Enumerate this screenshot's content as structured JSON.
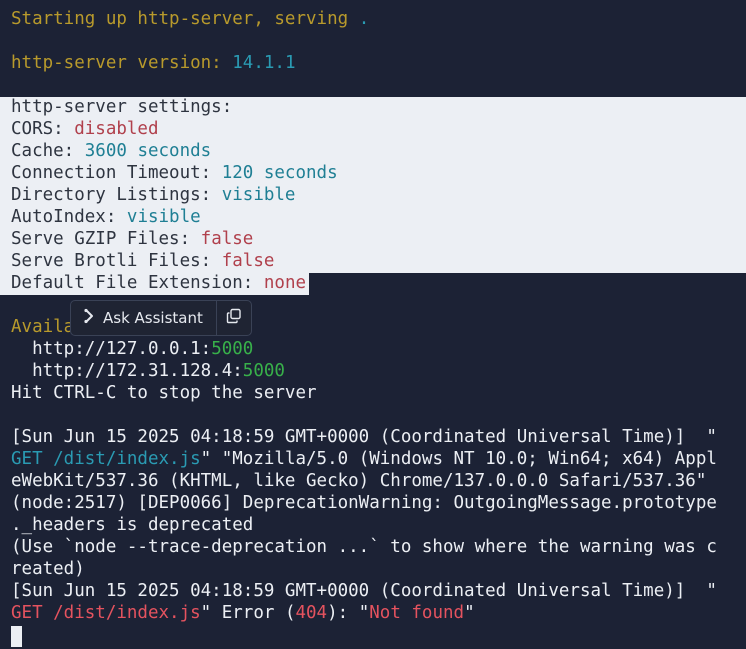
{
  "startup": {
    "prefix": "Starting up http-server, serving ",
    "path": "."
  },
  "version": {
    "label": "http-server version: ",
    "value": "14.1.1"
  },
  "settings": {
    "header": "http-server settings:",
    "cors": {
      "label": "CORS: ",
      "value": "disabled"
    },
    "cache": {
      "label": "Cache: ",
      "value": "3600 seconds"
    },
    "timeout": {
      "label": "Connection Timeout: ",
      "value": "120 seconds"
    },
    "listings": {
      "label": "Directory Listings: ",
      "value": "visible"
    },
    "autoindex": {
      "label": "AutoIndex: ",
      "value": "visible"
    },
    "gzip": {
      "label": "Serve GZIP Files: ",
      "value": "false"
    },
    "brotli": {
      "label": "Serve Brotli Files: ",
      "value": "false"
    },
    "ext": {
      "label": "Default File Extension: ",
      "value": "none"
    }
  },
  "available": {
    "label": "Availa",
    "urls": [
      {
        "host": "  http://127.0.0.1:",
        "port": "5000"
      },
      {
        "host": "  http://172.31.128.4:",
        "port": "5000"
      }
    ],
    "hint": "Hit CTRL-C to stop the server"
  },
  "log": {
    "line1": "[Sun Jun 15 2025 04:18:59 GMT+0000 (Coordinated Universal Time)]  \"",
    "line2_path": "GET /dist/index.js",
    "line2_rest": "\" \"Mozilla/5.0 (Windows NT 10.0; Win64; x64) Appl",
    "line3": "eWebKit/537.36 (KHTML, like Gecko) Chrome/137.0.0.0 Safari/537.36\"",
    "line4": "(node:2517) [DEP0066] DeprecationWarning: OutgoingMessage.prototype",
    "line5": "._headers is deprecated",
    "line6": "(Use `node --trace-deprecation ...` to show where the warning was c",
    "line7": "reated)",
    "line8": "[Sun Jun 15 2025 04:18:59 GMT+0000 (Coordinated Universal Time)]  \"",
    "line9_path": "GET /dist/index.js",
    "line9_mid": "\" Error (",
    "line9_code": "404",
    "line9_mid2": "): \"",
    "line9_msg": "Not found",
    "line9_end": "\""
  },
  "popup": {
    "assistant_label": "Ask Assistant"
  }
}
